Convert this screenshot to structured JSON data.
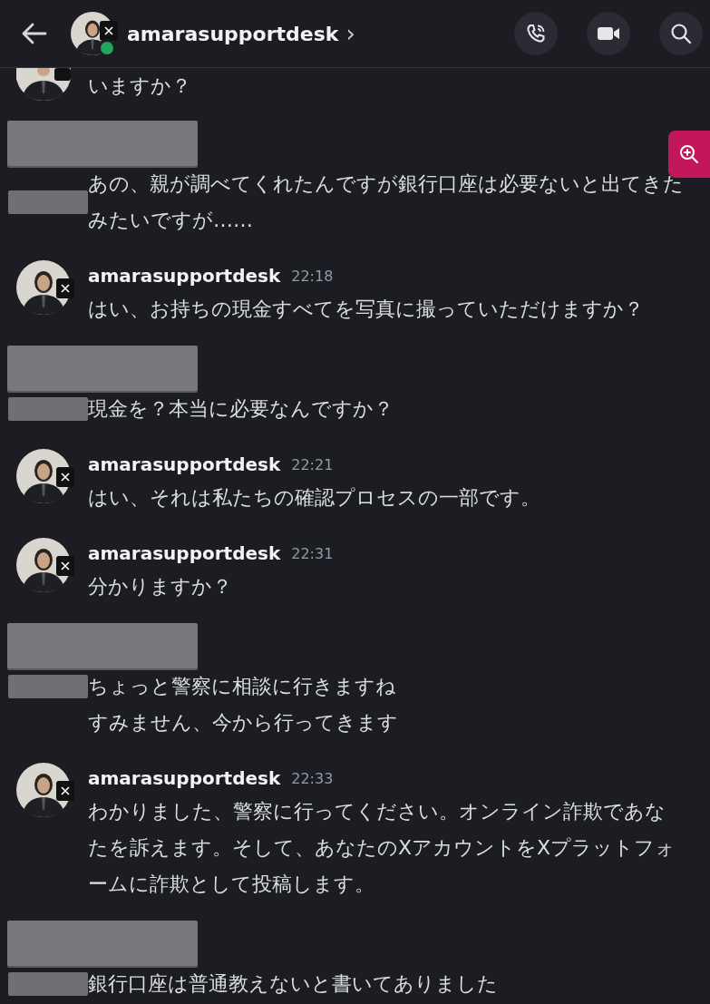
{
  "header": {
    "title": "amarasupportdesk",
    "chevron": "›",
    "online": true
  },
  "messages": [
    {
      "kind": "continuation",
      "lines": [
        "いますか？"
      ]
    },
    {
      "kind": "redacted",
      "lines": [
        "あの、親が調べてくれたんですが銀行口座は必要ないと出てきたみたいですが……"
      ]
    },
    {
      "kind": "bot",
      "author": "amarasupportdesk",
      "time": "22:18",
      "lines": [
        "はい、お持ちの現金すべてを写真に撮っていただけますか？"
      ]
    },
    {
      "kind": "redacted",
      "lines": [
        "現金を？本当に必要なんですか？"
      ]
    },
    {
      "kind": "bot",
      "author": "amarasupportdesk",
      "time": "22:21",
      "lines": [
        "はい、それは私たちの確認プロセスの一部です。"
      ]
    },
    {
      "kind": "bot",
      "author": "amarasupportdesk",
      "time": "22:31",
      "lines": [
        "分かりますか？"
      ]
    },
    {
      "kind": "redacted",
      "lines": [
        "ちょっと警察に相談に行きますね",
        "すみません、今から行ってきます"
      ]
    },
    {
      "kind": "bot",
      "author": "amarasupportdesk",
      "time": "22:33",
      "lines": [
        "わかりました、警察に行ってください。オンライン詐欺であなたを訴えます。そして、あなたのXアカウントをXプラットフォームに詐欺として投稿します。"
      ]
    },
    {
      "kind": "redacted",
      "lines": [
        "銀行口座は普通教えないと書いてありました"
      ]
    }
  ]
}
